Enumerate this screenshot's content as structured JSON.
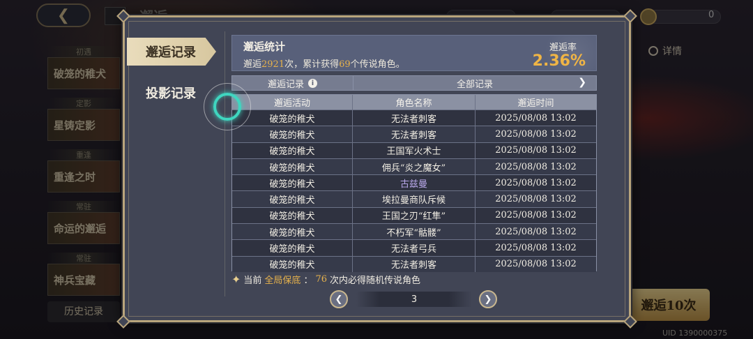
{
  "background": {
    "top_title": "邂逅",
    "currency_value": "0",
    "banners": [
      {
        "tag": "初遇",
        "label": "破笼的稚犬"
      },
      {
        "tag": "定影",
        "label": "星铸定影"
      },
      {
        "tag": "重逢",
        "label": "重逢之时"
      },
      {
        "tag": "常驻",
        "label": "命运的邂逅"
      },
      {
        "tag": "常驻",
        "label": "神兵宝藏"
      }
    ],
    "history_label": "历史记录",
    "detail_label": "详情",
    "summon10_label": "邂逅10次",
    "uid": "UID 1390000375"
  },
  "tabs": [
    {
      "label": "邂逅记录",
      "active": true
    },
    {
      "label": "投影记录",
      "active": false
    }
  ],
  "stats": {
    "title": "邂逅统计",
    "prefix": "邂逅",
    "count": "2921",
    "middle": "次，累计获得",
    "legend_count": "69",
    "suffix": "个传说角色。",
    "rate_label": "邂逅率",
    "rate_value": "2.36%"
  },
  "filter": {
    "left_label": "邂逅记录",
    "right_label": "全部记录"
  },
  "table": {
    "headers": [
      "邂逅活动",
      "角色名称",
      "邂逅时间"
    ],
    "rows": [
      {
        "event": "破笼的稚犬",
        "name": "无法者刺客",
        "time": "2025/08/08 13:02"
      },
      {
        "event": "破笼的稚犬",
        "name": "无法者刺客",
        "time": "2025/08/08 13:02"
      },
      {
        "event": "破笼的稚犬",
        "name": "王国军火术士",
        "time": "2025/08/08 13:02"
      },
      {
        "event": "破笼的稚犬",
        "name": "佣兵“炎之魔女”",
        "time": "2025/08/08 13:02"
      },
      {
        "event": "破笼的稚犬",
        "name": "古兹曼",
        "time": "2025/08/08 13:02"
      },
      {
        "event": "破笼的稚犬",
        "name": "埃拉曼商队斥候",
        "time": "2025/08/08 13:02"
      },
      {
        "event": "破笼的稚犬",
        "name": "王国之刃“红隼”",
        "time": "2025/08/08 13:02"
      },
      {
        "event": "破笼的稚犬",
        "name": "不朽军“骷髅”",
        "time": "2025/08/08 13:02"
      },
      {
        "event": "破笼的稚犬",
        "name": "无法者弓兵",
        "time": "2025/08/08 13:02"
      },
      {
        "event": "破笼的稚犬",
        "name": "无法者刺客",
        "time": "2025/08/08 13:02"
      }
    ]
  },
  "pity": {
    "prefix": "当前",
    "highlight": "全局保底",
    "colon": "：",
    "count": "76",
    "suffix": "次内必得随机传说角色"
  },
  "pager": {
    "page": "3"
  },
  "colors": {
    "accent_gold": "#f0b545",
    "modal_bg": "#414555",
    "frame": "#b9a57c",
    "rare_name": "#b9a8ea",
    "touch_ring": "#3fd6c0"
  }
}
